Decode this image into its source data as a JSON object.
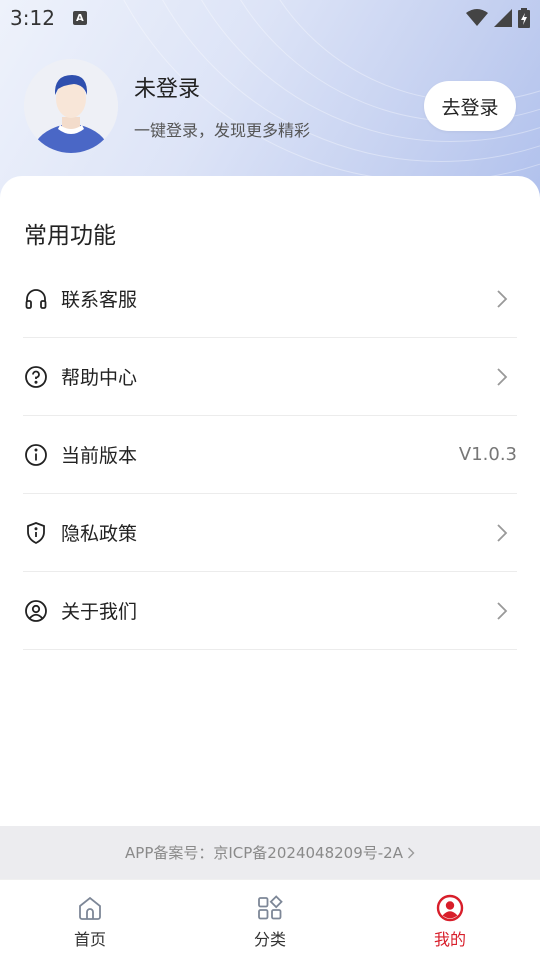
{
  "status_bar": {
    "time": "3:12",
    "notification_badge": "A"
  },
  "profile": {
    "name": "未登录",
    "subtitle": "一键登录，发现更多精彩",
    "login_button": "去登录"
  },
  "section": {
    "title": "常用功能"
  },
  "menu": [
    {
      "label": "联系客服",
      "icon": "headset-icon",
      "value": ""
    },
    {
      "label": "帮助中心",
      "icon": "question-circle-icon",
      "value": ""
    },
    {
      "label": "当前版本",
      "icon": "info-circle-icon",
      "value": "V1.0.3"
    },
    {
      "label": "隐私政策",
      "icon": "shield-info-icon",
      "value": ""
    },
    {
      "label": "关于我们",
      "icon": "user-circle-icon",
      "value": ""
    }
  ],
  "icp": {
    "text": "APP备案号：京ICP备2024048209号-2A"
  },
  "tabbar": {
    "tabs": [
      {
        "label": "首页",
        "icon": "home-icon",
        "active": false
      },
      {
        "label": "分类",
        "icon": "grid-icon",
        "active": false
      },
      {
        "label": "我的",
        "icon": "user-circle-filled-icon",
        "active": true
      }
    ]
  },
  "colors": {
    "accent": "#d81e2a",
    "header_gradient_start": "#eef2fb",
    "header_gradient_end": "#aebfec"
  }
}
